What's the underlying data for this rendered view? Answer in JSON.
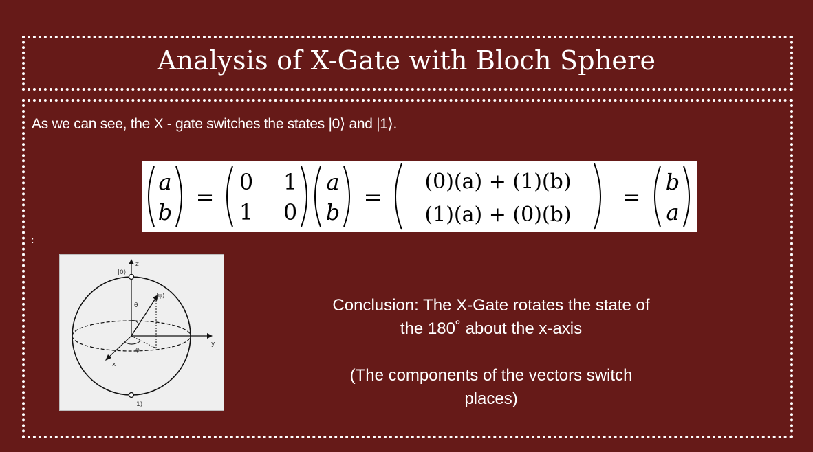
{
  "slide": {
    "title": "Analysis of X-Gate with Bloch Sphere",
    "intro": "As we can see, the X - gate switches the states |0⟩ and |1⟩.",
    "stray_mark": ":",
    "conclusion_line1": "Conclusion: The X-Gate rotates the state of",
    "conclusion_line2": "the 180˚ about the x-axis",
    "components_line1": "(The components of the vectors switch",
    "components_line2": "places)"
  },
  "equation": {
    "lhs_top": "a",
    "lhs_bottom": "b",
    "equals": "=",
    "m11": "0",
    "m12": "1",
    "m21": "1",
    "m22": "0",
    "vec_top": "a",
    "vec_bottom": "b",
    "res_top": "(0)(a) + (1)(b)",
    "res_bottom": "(1)(a) + (0)(b)",
    "out_top": "b",
    "out_bottom": "a"
  },
  "bloch_sphere": {
    "label_zero": "|0⟩",
    "label_one": "|1⟩",
    "label_z": "z",
    "label_y": "y",
    "label_x": "x",
    "label_psi": "|ψ⟩",
    "label_theta": "θ",
    "label_phi": "φ"
  },
  "colors": {
    "background": "#661a18",
    "text": "#ffffff",
    "panel": "#ffffff"
  }
}
